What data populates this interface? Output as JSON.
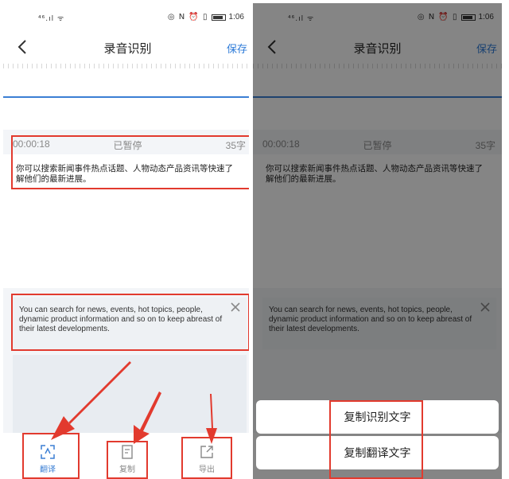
{
  "status_bar": {
    "signal": "⁴⁶.ıl ᯤ",
    "icons": "◎ N ⏰ ▯",
    "time": "1:06"
  },
  "nav": {
    "title": "录音识别",
    "save_label": "保存"
  },
  "recording": {
    "time": "00:00:18",
    "status": "已暂停",
    "char_count": "35字",
    "text": "你可以搜索新闻事件热点话题、人物动态产品资讯等快速了解他们的最新进展。"
  },
  "translation": {
    "text": "You can search for news, events, hot topics, people, dynamic product information and so on to keep abreast of their latest developments."
  },
  "toolbar": {
    "translate_label": "翻译",
    "copy_label": "复制",
    "export_label": "导出"
  },
  "copy_sheet": {
    "copy_recognized_label": "复制识别文字",
    "copy_translated_label": "复制翻译文字"
  },
  "colors": {
    "accent": "#3b7fd4",
    "highlight": "#e23a2e"
  }
}
